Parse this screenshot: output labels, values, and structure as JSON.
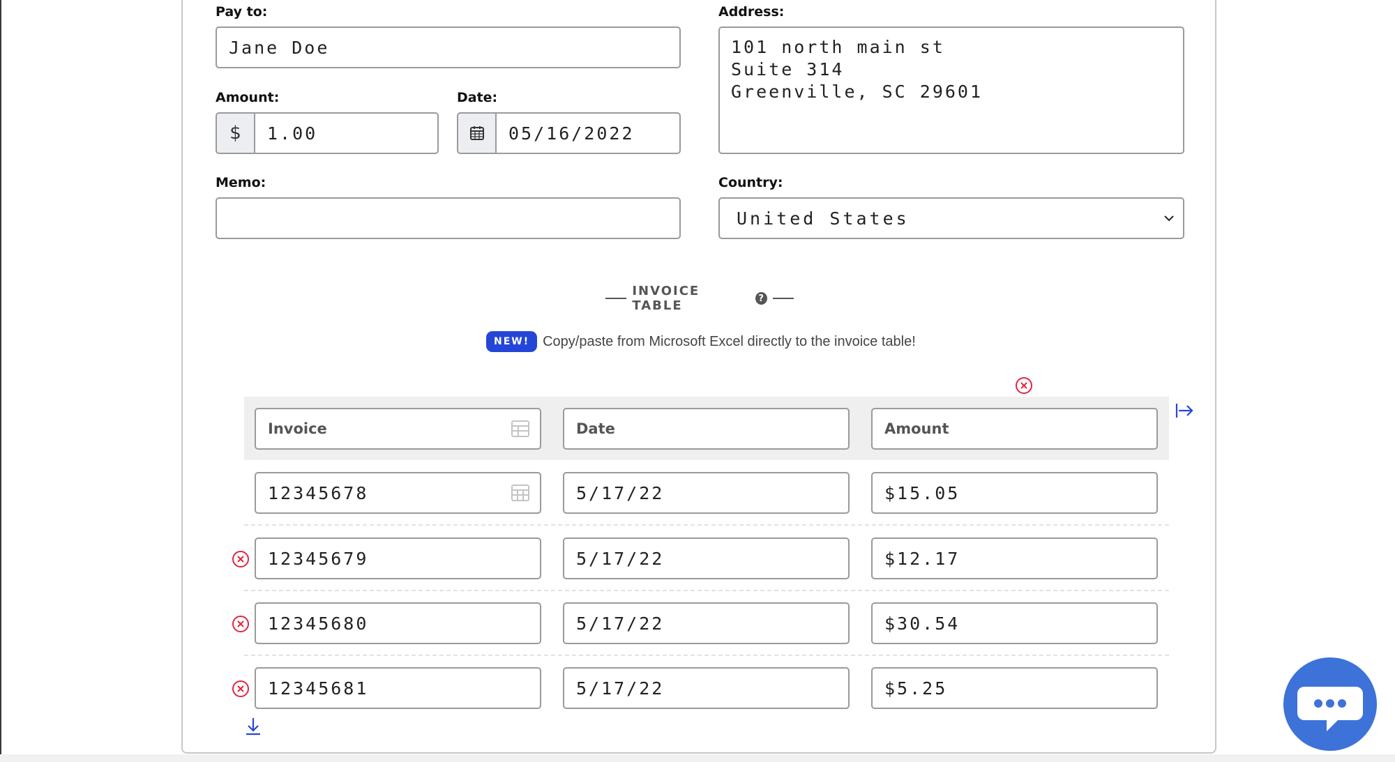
{
  "form": {
    "pay_to_label": "Pay to:",
    "pay_to_value": "Jane Doe",
    "address_label": "Address:",
    "address_lines": [
      "101 north main st",
      "Suite 314",
      "Greenville, SC 29601"
    ],
    "amount_label": "Amount:",
    "amount_prefix": "$",
    "amount_value": "1.00",
    "date_label": "Date:",
    "date_value": "05/16/2022",
    "memo_label": "Memo:",
    "memo_value": "",
    "country_label": "Country:",
    "country_value": "United States"
  },
  "invoice_table": {
    "title": "INVOICE TABLE",
    "help_glyph": "?",
    "badge": "NEW!",
    "promo": "Copy/paste from Microsoft Excel directly to the invoice table!",
    "headers": [
      "Invoice",
      "Date",
      "Amount"
    ],
    "rows": [
      {
        "invoice": "12345678",
        "date": "5/17/22",
        "amount": "$15.05"
      },
      {
        "invoice": "12345679",
        "date": "5/17/22",
        "amount": "$12.17"
      },
      {
        "invoice": "12345680",
        "date": "5/17/22",
        "amount": "$30.54"
      },
      {
        "invoice": "12345681",
        "date": "5/17/22",
        "amount": "$5.25"
      }
    ]
  },
  "icons": {
    "calendar": "calendar-icon",
    "chevron": "chevron-down-icon",
    "remove": "remove-circle-icon",
    "add_column": "add-column-icon",
    "add_row": "add-row-icon",
    "table_grid": "table-grid-icon",
    "chat": "chat-icon"
  },
  "colors": {
    "accent": "#2446d8",
    "remove": "#e0263f",
    "chat_bubble": "#3d72d9"
  }
}
